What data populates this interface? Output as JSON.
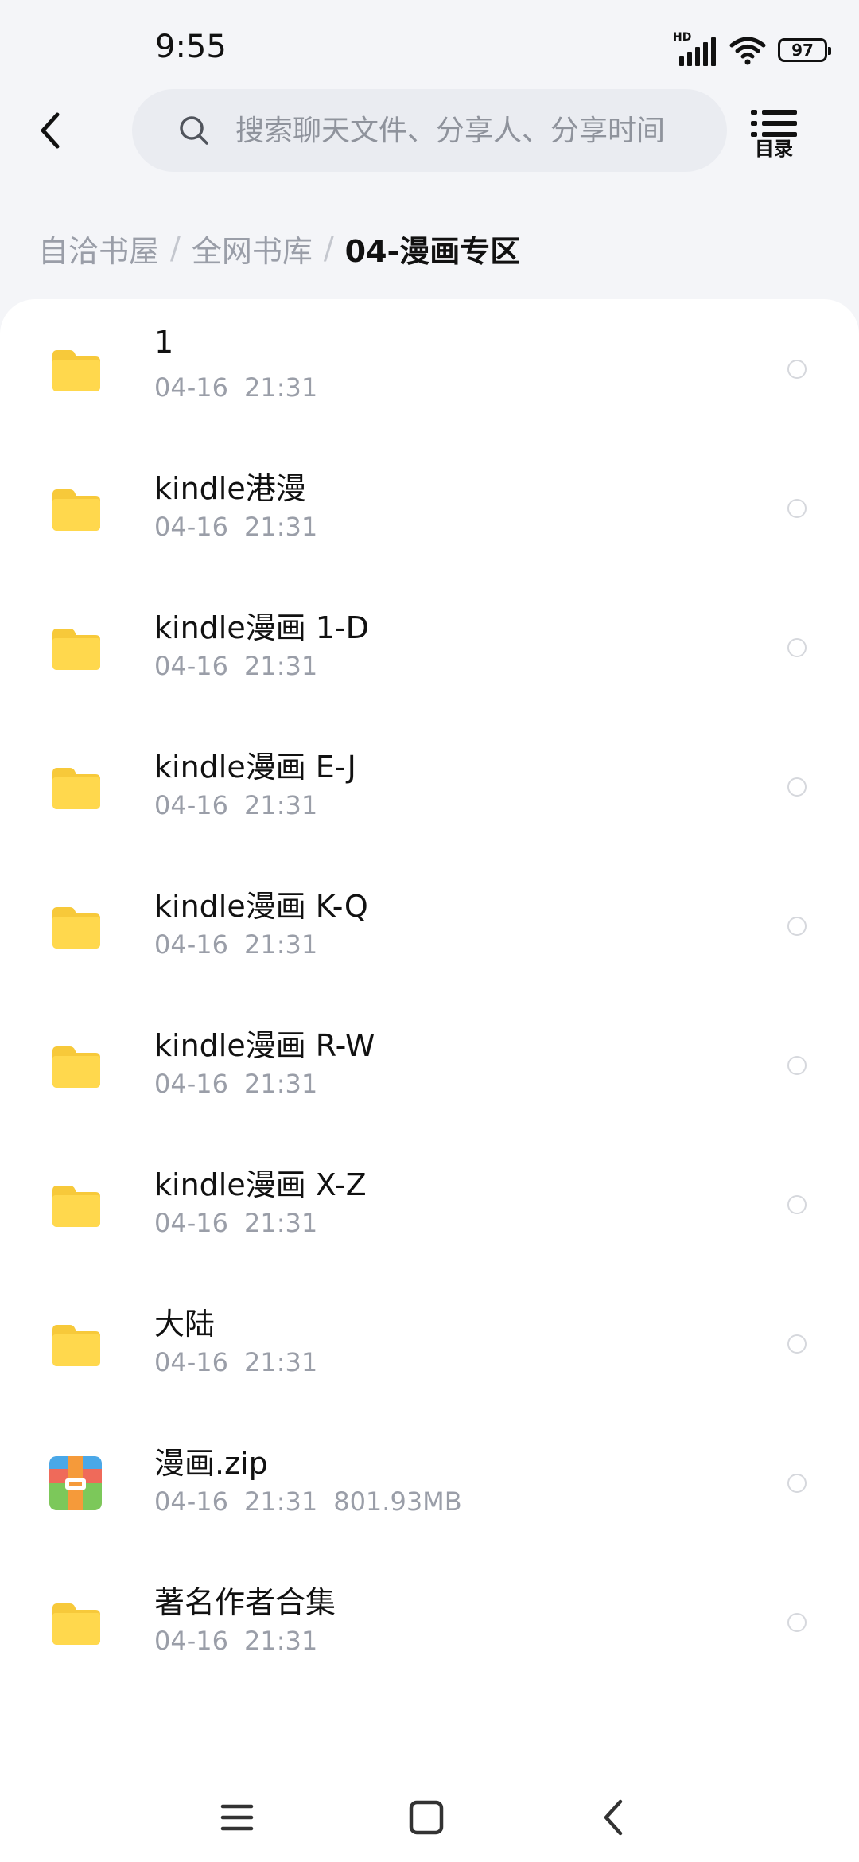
{
  "status_bar": {
    "time": "9:55",
    "network_label": "HD",
    "battery": "97"
  },
  "header": {
    "search_placeholder": "搜索聊天文件、分享人、分享时间",
    "toc_label": "目录"
  },
  "breadcrumb": [
    "自洽书屋",
    "全网书库",
    "04-漫画专区"
  ],
  "files": [
    {
      "name": "1",
      "date": "04-16",
      "time": "21:31",
      "size": "",
      "type": "folder"
    },
    {
      "name": "kindle港漫",
      "date": "04-16",
      "time": "21:31",
      "size": "",
      "type": "folder"
    },
    {
      "name": "kindle漫画 1-D",
      "date": "04-16",
      "time": "21:31",
      "size": "",
      "type": "folder"
    },
    {
      "name": "kindle漫画 E-J",
      "date": "04-16",
      "time": "21:31",
      "size": "",
      "type": "folder"
    },
    {
      "name": "kindle漫画 K-Q",
      "date": "04-16",
      "time": "21:31",
      "size": "",
      "type": "folder"
    },
    {
      "name": "kindle漫画 R-W",
      "date": "04-16",
      "time": "21:31",
      "size": "",
      "type": "folder"
    },
    {
      "name": "kindle漫画 X-Z",
      "date": "04-16",
      "time": "21:31",
      "size": "",
      "type": "folder"
    },
    {
      "name": "大陆",
      "date": "04-16",
      "time": "21:31",
      "size": "",
      "type": "folder"
    },
    {
      "name": "漫画.zip",
      "date": "04-16",
      "time": "21:31",
      "size": "801.93MB",
      "type": "zip"
    },
    {
      "name": "著名作者合集",
      "date": "04-16",
      "time": "21:31",
      "size": "",
      "type": "folder"
    }
  ],
  "colors": {
    "folder": "#ffd84d",
    "folder_tab": "#f7c93a",
    "accent_text": "#111111",
    "muted_text": "#9a9ea8"
  },
  "icons": {
    "folder": "folder-icon",
    "zip": "zip-file-icon"
  }
}
